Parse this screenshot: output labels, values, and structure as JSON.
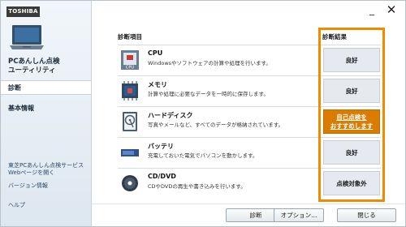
{
  "sidebar": {
    "brand": "TOSHIBA",
    "app_title_line1": "PCあんしん点検",
    "app_title_line2": "ユーティリティ",
    "nav": {
      "diagnose": "診断",
      "basic_info": "基本情報"
    },
    "links": {
      "service_line1": "東芝PCあんしん点検サービス",
      "service_line2": "Webページを開く",
      "version": "バージョン情報",
      "help": "ヘルプ"
    }
  },
  "main": {
    "col_item": "診断項目",
    "col_result": "診断結果",
    "items": [
      {
        "name": "CPU",
        "desc": "Windowsやソフトウェアの計算や処理を行います。",
        "result": "良好",
        "icon": "cpu-icon"
      },
      {
        "name": "メモリ",
        "desc": "計算や処理に必要なデータを一時的に保存します。",
        "result": "良好",
        "icon": "memory-icon"
      },
      {
        "name": "ハードディスク",
        "desc": "写真やメールなど、すべてのデータが格納されています。",
        "result_line1": "自己点検を",
        "result_line2": "おすすめします",
        "icon": "hard-disk-icon"
      },
      {
        "name": "バッテリ",
        "desc": "充電しておいた電気でパソコンを動かします。",
        "result": "良好",
        "icon": "battery-icon"
      },
      {
        "name": "CD/DVD",
        "desc": "CDやDVDの再生や書き込みを行います。",
        "result": "点検対象外",
        "icon": "disc-icon"
      }
    ]
  },
  "footer": {
    "diagnose": "診断",
    "options": "オプション...",
    "close": "閉じる"
  },
  "icon_text": {
    "cpu_chip_label": "CPU"
  },
  "colors": {
    "warning_result": "#d97c00",
    "highlight_border": "#f08a00"
  }
}
